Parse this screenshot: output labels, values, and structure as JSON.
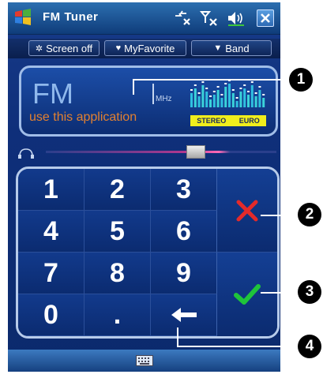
{
  "window": {
    "title": "FM Tuner"
  },
  "toolbar": {
    "screen_off": "Screen off",
    "my_favorite": "MyFavorite",
    "band": "Band"
  },
  "display": {
    "band": "FM",
    "unit": "MHz",
    "hint": "use this application",
    "stereo": "STEREO",
    "region": "EURO"
  },
  "keypad": {
    "keys": [
      "1",
      "2",
      "3",
      "4",
      "5",
      "6",
      "7",
      "8",
      "9",
      "0",
      "."
    ]
  },
  "volume": {
    "level": 0.65
  },
  "callouts": [
    "1",
    "2",
    "3",
    "4"
  ],
  "colors": {
    "cancel": "#e42a2a",
    "ok": "#1fc43a",
    "hint": "#e28030",
    "badge": "#f0ee1c"
  }
}
